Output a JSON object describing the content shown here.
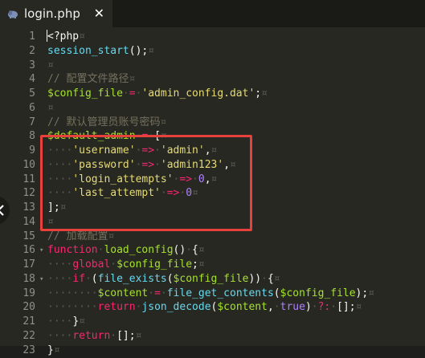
{
  "tab": {
    "title": "login.php",
    "close": "✕"
  },
  "code_lines": [
    {
      "n": "1",
      "fold": "",
      "tokens": [
        [
          "plain",
          "<?php"
        ],
        [
          "ws",
          "¤"
        ]
      ]
    },
    {
      "n": "2",
      "fold": "",
      "tokens": [
        [
          "func",
          "session_start"
        ],
        [
          "plain",
          "();"
        ],
        [
          "ws",
          "¤"
        ]
      ]
    },
    {
      "n": "3",
      "fold": "",
      "tokens": [
        [
          "ws",
          "¤"
        ]
      ]
    },
    {
      "n": "4",
      "fold": "",
      "tokens": [
        [
          "com",
          "// 配置文件路径"
        ],
        [
          "ws",
          "¤"
        ]
      ]
    },
    {
      "n": "5",
      "fold": "",
      "tokens": [
        [
          "var",
          "$config_file"
        ],
        [
          "ws",
          "·"
        ],
        [
          "op",
          "="
        ],
        [
          "ws",
          "·"
        ],
        [
          "str",
          "'admin_config.dat'"
        ],
        [
          "plain",
          ";"
        ],
        [
          "ws",
          "¤"
        ]
      ]
    },
    {
      "n": "6",
      "fold": "",
      "tokens": [
        [
          "ws",
          "¤"
        ]
      ]
    },
    {
      "n": "7",
      "fold": "",
      "tokens": [
        [
          "com",
          "// 默认管理员账号密码"
        ],
        [
          "ws",
          "¤"
        ]
      ]
    },
    {
      "n": "8",
      "fold": "",
      "tokens": [
        [
          "var",
          "$default_admin"
        ],
        [
          "ws",
          "·"
        ],
        [
          "op",
          "="
        ],
        [
          "ws",
          "·"
        ],
        [
          "plain",
          "["
        ],
        [
          "ws",
          "¤"
        ]
      ]
    },
    {
      "n": "9",
      "fold": "",
      "tokens": [
        [
          "ws",
          "····"
        ],
        [
          "str",
          "'username'"
        ],
        [
          "ws",
          "·"
        ],
        [
          "op",
          "=>"
        ],
        [
          "ws",
          "·"
        ],
        [
          "str",
          "'admin'"
        ],
        [
          "plain",
          ","
        ],
        [
          "ws",
          "¤"
        ]
      ]
    },
    {
      "n": "10",
      "fold": "",
      "tokens": [
        [
          "ws",
          "····"
        ],
        [
          "str",
          "'password'"
        ],
        [
          "ws",
          "·"
        ],
        [
          "op",
          "=>"
        ],
        [
          "ws",
          "·"
        ],
        [
          "str",
          "'admin123'"
        ],
        [
          "plain",
          ","
        ],
        [
          "ws",
          "¤"
        ]
      ]
    },
    {
      "n": "11",
      "fold": "",
      "tokens": [
        [
          "ws",
          "····"
        ],
        [
          "str",
          "'login_attempts'"
        ],
        [
          "ws",
          "·"
        ],
        [
          "op",
          "=>"
        ],
        [
          "ws",
          "·"
        ],
        [
          "num",
          "0"
        ],
        [
          "plain",
          ","
        ],
        [
          "ws",
          "¤"
        ]
      ]
    },
    {
      "n": "12",
      "fold": "",
      "tokens": [
        [
          "ws",
          "····"
        ],
        [
          "str",
          "'last_attempt'"
        ],
        [
          "ws",
          "·"
        ],
        [
          "op",
          "=>"
        ],
        [
          "ws",
          "·"
        ],
        [
          "num",
          "0"
        ],
        [
          "ws",
          "¤"
        ]
      ]
    },
    {
      "n": "13",
      "fold": "",
      "tokens": [
        [
          "plain",
          "];"
        ],
        [
          "ws",
          "¤"
        ]
      ]
    },
    {
      "n": "14",
      "fold": "",
      "tokens": [
        [
          "ws",
          "¤"
        ]
      ]
    },
    {
      "n": "15",
      "fold": "",
      "tokens": [
        [
          "com",
          "// 加载配置"
        ],
        [
          "ws",
          "¤"
        ]
      ]
    },
    {
      "n": "16",
      "fold": "▾",
      "tokens": [
        [
          "kw",
          "function"
        ],
        [
          "ws",
          "·"
        ],
        [
          "var",
          "load_config"
        ],
        [
          "plain",
          "()"
        ],
        [
          "ws",
          "·"
        ],
        [
          "plain",
          "{"
        ],
        [
          "ws",
          "¤"
        ]
      ]
    },
    {
      "n": "17",
      "fold": "",
      "tokens": [
        [
          "ws",
          "····"
        ],
        [
          "kw",
          "global"
        ],
        [
          "ws",
          "·"
        ],
        [
          "var",
          "$config_file"
        ],
        [
          "plain",
          ";"
        ],
        [
          "ws",
          "¤"
        ]
      ]
    },
    {
      "n": "18",
      "fold": "▾",
      "tokens": [
        [
          "ws",
          "····"
        ],
        [
          "kw",
          "if"
        ],
        [
          "ws",
          "·"
        ],
        [
          "plain",
          "("
        ],
        [
          "func",
          "file_exists"
        ],
        [
          "plain",
          "("
        ],
        [
          "var",
          "$config_file"
        ],
        [
          "plain",
          "))"
        ],
        [
          "ws",
          "·"
        ],
        [
          "plain",
          "{"
        ],
        [
          "ws",
          "¤"
        ]
      ]
    },
    {
      "n": "19",
      "fold": "",
      "tokens": [
        [
          "ws",
          "········"
        ],
        [
          "var",
          "$content"
        ],
        [
          "ws",
          "·"
        ],
        [
          "op",
          "="
        ],
        [
          "ws",
          "·"
        ],
        [
          "func",
          "file_get_contents"
        ],
        [
          "plain",
          "("
        ],
        [
          "var",
          "$config_file"
        ],
        [
          "plain",
          ");"
        ],
        [
          "ws",
          "¤"
        ]
      ]
    },
    {
      "n": "20",
      "fold": "",
      "tokens": [
        [
          "ws",
          "········"
        ],
        [
          "kw",
          "return"
        ],
        [
          "ws",
          "·"
        ],
        [
          "func",
          "json_decode"
        ],
        [
          "plain",
          "("
        ],
        [
          "var",
          "$content"
        ],
        [
          "plain",
          ","
        ],
        [
          "ws",
          "·"
        ],
        [
          "const",
          "true"
        ],
        [
          "plain",
          ")"
        ],
        [
          "ws",
          "·"
        ],
        [
          "op",
          "?:"
        ],
        [
          "ws",
          "·"
        ],
        [
          "plain",
          "[];"
        ],
        [
          "ws",
          "¤"
        ]
      ]
    },
    {
      "n": "21",
      "fold": "",
      "tokens": [
        [
          "ws",
          "····"
        ],
        [
          "plain",
          "}"
        ],
        [
          "ws",
          "¤"
        ]
      ]
    },
    {
      "n": "22",
      "fold": "",
      "tokens": [
        [
          "ws",
          "····"
        ],
        [
          "kw",
          "return"
        ],
        [
          "ws",
          "·"
        ],
        [
          "plain",
          "[];"
        ],
        [
          "ws",
          "¤"
        ]
      ]
    },
    {
      "n": "23",
      "fold": "",
      "tokens": [
        [
          "plain",
          "}"
        ],
        [
          "ws",
          "¤"
        ]
      ]
    }
  ],
  "colors": {
    "background": "#272822",
    "highlight_box": "#e8403a",
    "string": "#e6db74",
    "keyword": "#f92672",
    "function": "#66d9ef",
    "variable": "#a6e22e",
    "number": "#ae81ff",
    "comment": "#75715e"
  },
  "icons": {
    "tab_file": "php-elephant-icon",
    "side_handle": "chevron-left-icon"
  }
}
